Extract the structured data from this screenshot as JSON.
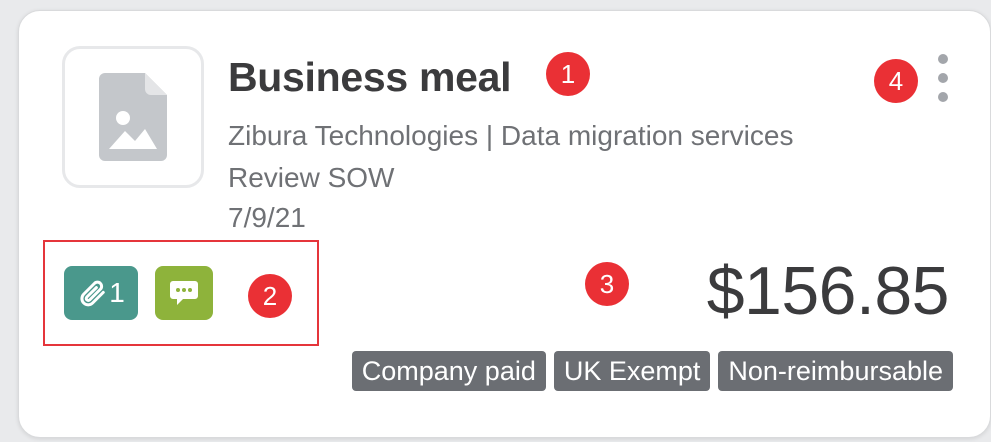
{
  "expense": {
    "title": "Business meal",
    "client_project": "Zibura Technologies | Data migration services",
    "description": "Review SOW",
    "date": "7/9/21",
    "amount": "$156.85",
    "attachments_count": "1",
    "tags": [
      "Company paid",
      "UK Exempt",
      "Non-reimbursable"
    ]
  },
  "markers": [
    "1",
    "2",
    "3",
    "4"
  ],
  "colors": {
    "attachment_badge": "#4a988c",
    "comment_badge": "#8eb33b",
    "marker": "#ea3035",
    "tag": "#6b6e73"
  },
  "icons": {
    "thumbnail": "image-file-icon",
    "attachment": "paperclip-icon",
    "comment": "comment-icon",
    "menu": "more-vertical-icon"
  }
}
